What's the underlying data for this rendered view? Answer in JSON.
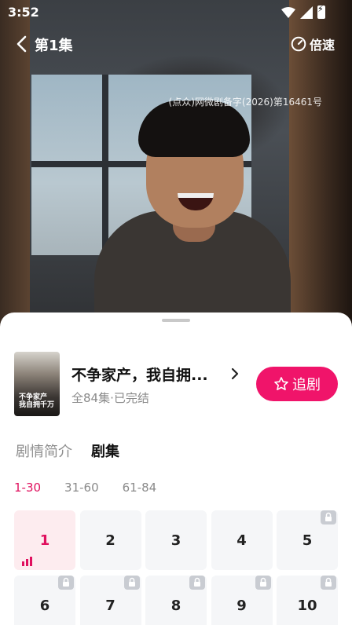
{
  "status_bar": {
    "time": "3:52"
  },
  "nav": {
    "episode_title": "第1集",
    "speed_label": "倍速"
  },
  "video": {
    "license_text": "(点众)网微剧备字(2026)第16461号"
  },
  "drama": {
    "title": "不争家产，我自拥...",
    "meta": "全84集·已完结",
    "follow_label": "追剧",
    "poster_text": "不争家产\n我自拥千万"
  },
  "tabs": [
    {
      "label": "剧情简介",
      "active": false
    },
    {
      "label": "剧集",
      "active": true
    }
  ],
  "ranges": [
    {
      "label": "1-30",
      "active": true
    },
    {
      "label": "31-60",
      "active": false
    },
    {
      "label": "61-84",
      "active": false
    }
  ],
  "episodes": [
    {
      "label": "1",
      "locked": false,
      "active": true
    },
    {
      "label": "2",
      "locked": false,
      "active": false
    },
    {
      "label": "3",
      "locked": false,
      "active": false
    },
    {
      "label": "4",
      "locked": false,
      "active": false
    },
    {
      "label": "5",
      "locked": true,
      "active": false
    },
    {
      "label": "6",
      "locked": true,
      "active": false
    },
    {
      "label": "7",
      "locked": true,
      "active": false
    },
    {
      "label": "8",
      "locked": true,
      "active": false
    },
    {
      "label": "9",
      "locked": true,
      "active": false
    },
    {
      "label": "10",
      "locked": true,
      "active": false
    }
  ],
  "colors": {
    "accent": "#f0146a",
    "active_text": "#e0105e",
    "active_tile": "#fdecef"
  }
}
